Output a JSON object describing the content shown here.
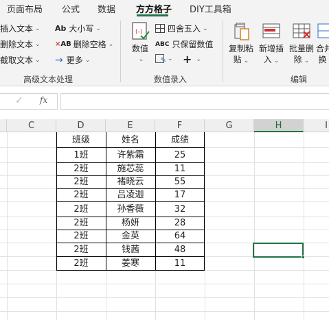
{
  "tabs": [
    {
      "label": "页面布局"
    },
    {
      "label": "公式"
    },
    {
      "label": "数据"
    },
    {
      "label": "方方格子"
    },
    {
      "label": "DIY工具箱"
    }
  ],
  "active_tab": "方方格子",
  "ribbon": {
    "text_group": {
      "insert_text": "插入文本",
      "delete_text": "删除文本",
      "cut_text": "截取文本",
      "case_btn": "大小写",
      "delete_space": "删除空格",
      "more": "更多",
      "group_label": "高级文本处理"
    },
    "number_group": {
      "number_btn": "数值",
      "round_btn": "四舍五入",
      "keep_value": "只保留数值",
      "group_label": "数值录入"
    },
    "edit_group": {
      "copy_paste_line1": "复制粘",
      "copy_paste_line2": "贴",
      "new_insert_line1": "新增插",
      "new_insert_line2": "入",
      "batch_delete_line1": "批量删",
      "batch_delete_line2": "除",
      "merge_line1": "合并",
      "merge_line2": "换",
      "group_label": "编辑"
    }
  },
  "formula_bar": {
    "fx": "fx",
    "cancel": "✓"
  },
  "columns": [
    "C",
    "D",
    "E",
    "F",
    "G",
    "H",
    "I"
  ],
  "selected_column": "H",
  "table": {
    "headers": [
      "班级",
      "姓名",
      "成绩"
    ],
    "rows": [
      [
        "1班",
        "许紫霜",
        "25"
      ],
      [
        "2班",
        "施芯蕊",
        "11"
      ],
      [
        "2班",
        "褚晓云",
        "55"
      ],
      [
        "2班",
        "吕凌迦",
        "17"
      ],
      [
        "2班",
        "孙香薇",
        "32"
      ],
      [
        "2班",
        "杨妍",
        "28"
      ],
      [
        "2班",
        "金英",
        "64"
      ],
      [
        "2班",
        "钱茜",
        "48"
      ],
      [
        "2班",
        "姜寒",
        "11"
      ]
    ]
  },
  "colors": {
    "accent": "#217346",
    "grid_line": "#e1e1e1",
    "header_bg": "#efefef"
  }
}
